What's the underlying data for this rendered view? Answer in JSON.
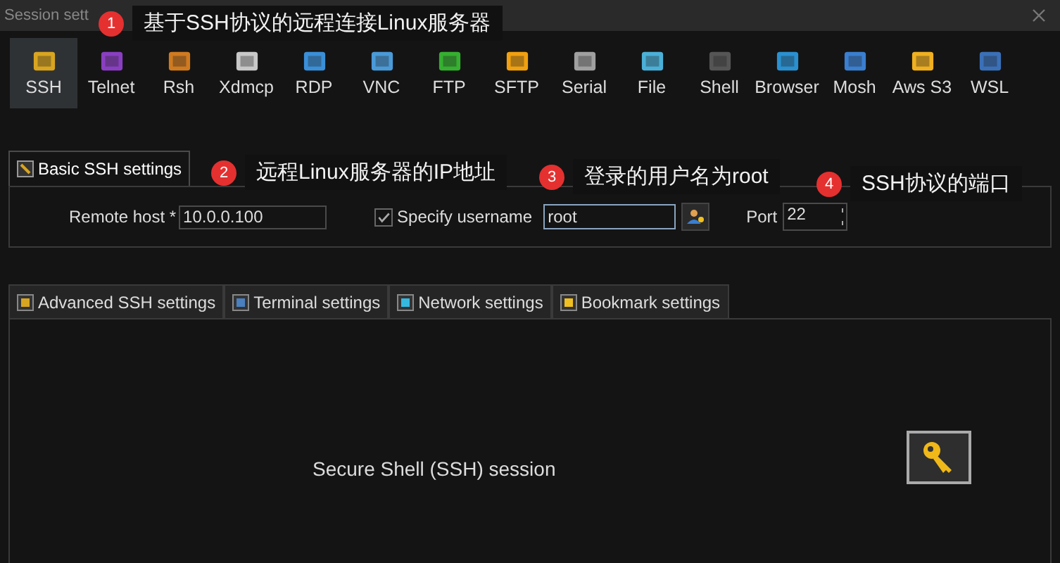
{
  "window": {
    "title": "Session sett"
  },
  "protocols": [
    {
      "label": "SSH",
      "selected": true
    },
    {
      "label": "Telnet",
      "selected": false
    },
    {
      "label": "Rsh",
      "selected": false
    },
    {
      "label": "Xdmcp",
      "selected": false
    },
    {
      "label": "RDP",
      "selected": false
    },
    {
      "label": "VNC",
      "selected": false
    },
    {
      "label": "FTP",
      "selected": false
    },
    {
      "label": "SFTP",
      "selected": false
    },
    {
      "label": "Serial",
      "selected": false
    },
    {
      "label": "File",
      "selected": false
    },
    {
      "label": "Shell",
      "selected": false
    },
    {
      "label": "Browser",
      "selected": false
    },
    {
      "label": "Mosh",
      "selected": false
    },
    {
      "label": "Aws S3",
      "selected": false
    },
    {
      "label": "WSL",
      "selected": false
    }
  ],
  "basic_tab": {
    "label": "Basic SSH settings",
    "selected": true
  },
  "basic": {
    "remote_host_label": "Remote host *",
    "remote_host": "10.0.0.100",
    "specify_username": {
      "label": "Specify username",
      "checked": true
    },
    "username": "root",
    "port_label": "Port",
    "port": "22"
  },
  "advanced_tabs": [
    {
      "label": "Advanced SSH settings",
      "selected": false
    },
    {
      "label": "Terminal settings",
      "selected": false
    },
    {
      "label": "Network settings",
      "selected": false
    },
    {
      "label": "Bookmark settings",
      "selected": false
    }
  ],
  "description": "Secure Shell (SSH) session",
  "annotations": [
    {
      "number": "1",
      "text": "基于SSH协议的远程连接Linux服务器"
    },
    {
      "number": "2",
      "text": "远程Linux服务器的IP地址"
    },
    {
      "number": "3",
      "text": "登录的用户名为root"
    },
    {
      "number": "4",
      "text": "SSH协议的端口"
    }
  ]
}
